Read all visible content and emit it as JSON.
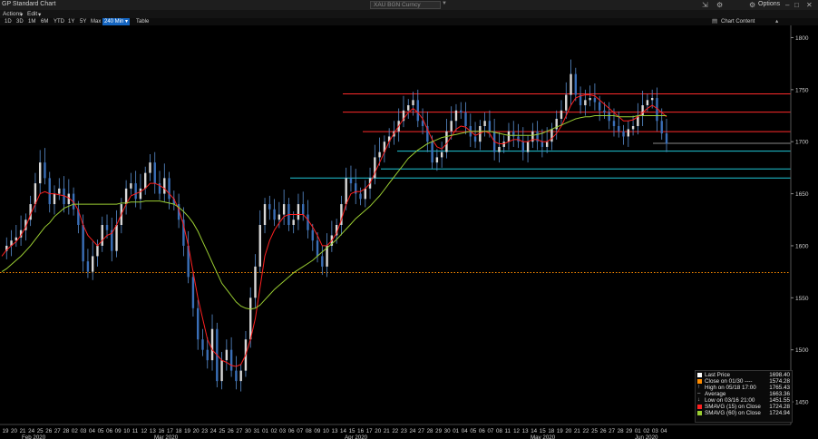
{
  "window": {
    "title": "GP Standard Chart",
    "ticker": "XAU BGN Curncy",
    "options_label": "Options"
  },
  "menu": {
    "actions": "Actions",
    "edit": "Edit"
  },
  "toolbar": {
    "periods": [
      "1D",
      "3D",
      "1M",
      "6M",
      "YTD",
      "1Y",
      "5Y",
      "Max"
    ],
    "interval": "240 Min",
    "table": "Table",
    "chart_content": "Chart Content"
  },
  "price_labels": {
    "p1745": "1745.98",
    "p1728": "1728.39",
    "p1709": "1709.67",
    "p1698": "1698.40",
    "p1690": "1690.94",
    "p1673": "1673.82",
    "p1665": "1665.05"
  },
  "legend": [
    {
      "label": "Last Price",
      "value": "1698.40",
      "color": "#ffffff",
      "marker": "square"
    },
    {
      "label": "Close on 01/30 ----",
      "value": "1574.28",
      "color": "#ff8c00",
      "marker": "square"
    },
    {
      "label": "High on 05/18 17:00",
      "value": "1765.43",
      "color": "#cccccc",
      "marker": "arrow-up"
    },
    {
      "label": "Average",
      "value": "1663.36",
      "color": "#cccccc",
      "marker": "line"
    },
    {
      "label": "Low on 03/16 21:00",
      "value": "1451.55",
      "color": "#cccccc",
      "marker": "arrow-down"
    },
    {
      "label": "SMAVG (15)  on Close",
      "value": "1724.28",
      "color": "#ff2020",
      "marker": "square"
    },
    {
      "label": "SMAVG (60)  on Close",
      "value": "1724.94",
      "color": "#9acd32",
      "marker": "square"
    }
  ],
  "chart_data": {
    "type": "line",
    "title": "",
    "ylim": [
      1430,
      1810
    ],
    "y_ticks": [
      1450,
      1500,
      1550,
      1600,
      1650,
      1700,
      1750,
      1800
    ],
    "x_day_labels": [
      "19",
      "20",
      "21",
      "24",
      "25",
      "26",
      "27",
      "28",
      "02",
      "03",
      "04",
      "05",
      "06",
      "09",
      "10",
      "11",
      "12",
      "13",
      "16",
      "17",
      "18",
      "19",
      "20",
      "23",
      "24",
      "25",
      "26",
      "27",
      "30",
      "31",
      "01",
      "02",
      "03",
      "06",
      "07",
      "08",
      "09",
      "10",
      "13",
      "14",
      "15",
      "16",
      "17",
      "20",
      "21",
      "22",
      "23",
      "24",
      "27",
      "28",
      "29",
      "30",
      "01",
      "04",
      "05",
      "06",
      "07",
      "08",
      "11",
      "12",
      "13",
      "14",
      "15",
      "18",
      "19",
      "20",
      "21",
      "22",
      "25",
      "26",
      "27",
      "28",
      "29",
      "01",
      "02",
      "03",
      "04"
    ],
    "x_month_labels": [
      "Feb 2020",
      "Mar 2020",
      "Apr 2020",
      "May 2020",
      "Jun 2020"
    ],
    "close_reference": 1574.28,
    "horizontal_levels": [
      {
        "value": 1745.98,
        "color": "#ff2a2a"
      },
      {
        "value": 1728.39,
        "color": "#ff2a2a"
      },
      {
        "value": 1709.67,
        "color": "#ff2a2a"
      },
      {
        "value": 1698.4,
        "color": "#888888"
      },
      {
        "value": 1690.94,
        "color": "#20c8d8"
      },
      {
        "value": 1673.82,
        "color": "#20c8d8"
      },
      {
        "value": 1665.05,
        "color": "#20c8d8"
      }
    ],
    "series": [
      {
        "name": "Last Price",
        "values": [
          1595,
          1600,
          1605,
          1608,
          1615,
          1625,
          1640,
          1660,
          1680,
          1665,
          1640,
          1650,
          1655,
          1640,
          1650,
          1635,
          1620,
          1585,
          1575,
          1590,
          1600,
          1620,
          1615,
          1595,
          1620,
          1640,
          1655,
          1660,
          1645,
          1655,
          1670,
          1680,
          1660,
          1650,
          1665,
          1645,
          1640,
          1625,
          1600,
          1570,
          1540,
          1510,
          1500,
          1490,
          1520,
          1470,
          1490,
          1500,
          1480,
          1470,
          1480,
          1510,
          1550,
          1580,
          1620,
          1640,
          1635,
          1625,
          1630,
          1640,
          1620,
          1625,
          1640,
          1630,
          1615,
          1605,
          1590,
          1580,
          1600,
          1610,
          1620,
          1640,
          1665,
          1660,
          1650,
          1645,
          1655,
          1665,
          1685,
          1690,
          1700,
          1705,
          1710,
          1720,
          1730,
          1735,
          1740,
          1720,
          1715,
          1700,
          1680,
          1685,
          1690,
          1710,
          1720,
          1730,
          1728,
          1715,
          1705,
          1700,
          1715,
          1720,
          1710,
          1690,
          1695,
          1700,
          1710,
          1705,
          1700,
          1690,
          1700,
          1710,
          1700,
          1695,
          1700,
          1712,
          1722,
          1730,
          1745,
          1765,
          1745,
          1735,
          1740,
          1742,
          1738,
          1730,
          1728,
          1720,
          1715,
          1710,
          1705,
          1712,
          1715,
          1725,
          1735,
          1740,
          1742,
          1720,
          1708,
          1698
        ]
      },
      {
        "name": "SMAVG (15)",
        "values": [
          1590,
          1596,
          1600,
          1604,
          1610,
          1618,
          1630,
          1640,
          1650,
          1652,
          1650,
          1650,
          1649,
          1648,
          1646,
          1642,
          1634,
          1620,
          1610,
          1605,
          1600,
          1605,
          1610,
          1612,
          1620,
          1630,
          1640,
          1648,
          1650,
          1652,
          1655,
          1660,
          1660,
          1658,
          1655,
          1650,
          1645,
          1635,
          1620,
          1600,
          1575,
          1550,
          1530,
          1510,
          1500,
          1495,
          1490,
          1488,
          1485,
          1484,
          1486,
          1495,
          1510,
          1530,
          1560,
          1590,
          1605,
          1615,
          1622,
          1628,
          1630,
          1630,
          1630,
          1630,
          1625,
          1618,
          1610,
          1600,
          1600,
          1605,
          1612,
          1625,
          1640,
          1650,
          1652,
          1652,
          1655,
          1660,
          1670,
          1680,
          1690,
          1700,
          1708,
          1715,
          1722,
          1728,
          1732,
          1728,
          1722,
          1712,
          1702,
          1695,
          1693,
          1698,
          1705,
          1712,
          1715,
          1714,
          1710,
          1706,
          1708,
          1710,
          1708,
          1700,
          1698,
          1698,
          1700,
          1702,
          1702,
          1700,
          1700,
          1702,
          1702,
          1700,
          1700,
          1703,
          1708,
          1715,
          1725,
          1735,
          1742,
          1744,
          1745,
          1745,
          1744,
          1740,
          1736,
          1732,
          1728,
          1724,
          1720,
          1720,
          1721,
          1724,
          1728,
          1732,
          1735,
          1732,
          1728,
          1724
        ]
      },
      {
        "name": "SMAVG (60)",
        "values": [
          1575,
          1578,
          1582,
          1586,
          1590,
          1595,
          1600,
          1606,
          1612,
          1618,
          1622,
          1628,
          1632,
          1636,
          1638,
          1640,
          1640,
          1640,
          1640,
          1640,
          1640,
          1640,
          1640,
          1640,
          1640,
          1641,
          1641,
          1642,
          1642,
          1642,
          1643,
          1643,
          1643,
          1643,
          1642,
          1641,
          1640,
          1637,
          1633,
          1628,
          1622,
          1614,
          1604,
          1594,
          1584,
          1574,
          1564,
          1558,
          1552,
          1546,
          1542,
          1540,
          1539,
          1540,
          1543,
          1548,
          1553,
          1558,
          1562,
          1566,
          1570,
          1574,
          1577,
          1580,
          1583,
          1586,
          1590,
          1594,
          1598,
          1602,
          1606,
          1611,
          1616,
          1621,
          1626,
          1630,
          1634,
          1638,
          1643,
          1648,
          1654,
          1660,
          1666,
          1672,
          1678,
          1684,
          1688,
          1692,
          1695,
          1698,
          1700,
          1702,
          1704,
          1705,
          1706,
          1707,
          1708,
          1709,
          1710,
          1710,
          1710,
          1710,
          1710,
          1709,
          1708,
          1707,
          1706,
          1706,
          1706,
          1706,
          1706,
          1706,
          1707,
          1708,
          1710,
          1712,
          1714,
          1716,
          1718,
          1720,
          1722,
          1723,
          1724,
          1724,
          1725,
          1725,
          1725,
          1725,
          1725,
          1724,
          1724,
          1724,
          1724,
          1725,
          1725,
          1725,
          1725,
          1725,
          1725,
          1725
        ]
      }
    ]
  }
}
